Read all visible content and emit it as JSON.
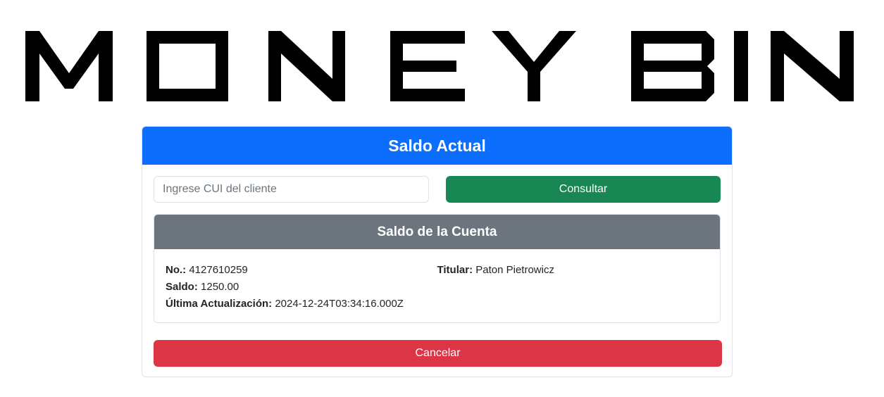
{
  "brand": {
    "logo_text": "MONEY BIN"
  },
  "card": {
    "title": "Saldo Actual"
  },
  "search": {
    "placeholder": "Ingrese CUI del cliente",
    "value": "",
    "button_label": "Consultar"
  },
  "account": {
    "title": "Saldo de la Cuenta",
    "number_label": "No.:",
    "number": "4127610259",
    "holder_label": "Titular:",
    "holder": "Paton Pietrowicz",
    "balance_label": "Saldo:",
    "balance": "1250.00",
    "updated_label": "Última Actualización:",
    "updated": "2024-12-24T03:34:16.000Z"
  },
  "actions": {
    "cancel_label": "Cancelar"
  },
  "colors": {
    "primary": "#0d6efd",
    "success": "#198754",
    "secondary": "#6c757d",
    "danger": "#dc3545"
  }
}
